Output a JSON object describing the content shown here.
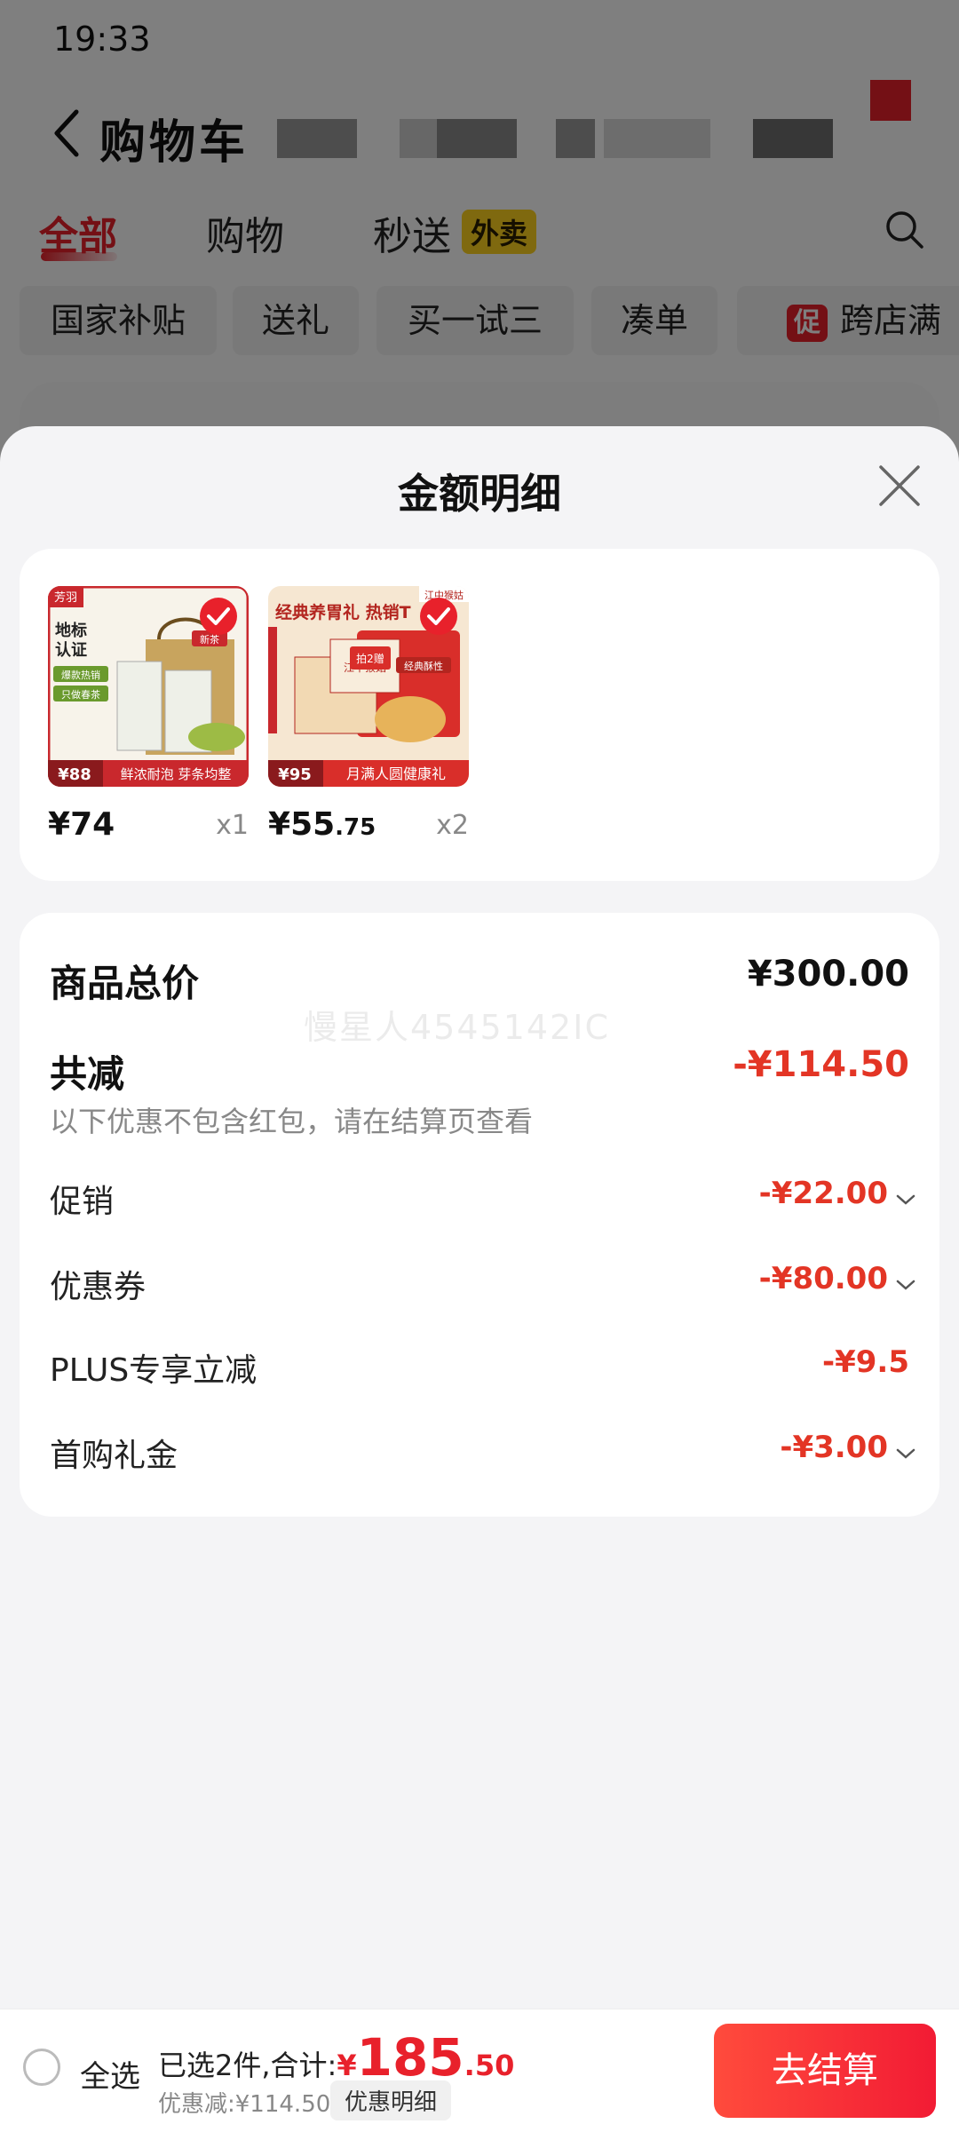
{
  "status_bar": {
    "time": "19:33"
  },
  "nav": {
    "title": "购物车"
  },
  "tabs": [
    {
      "label": "全部"
    },
    {
      "label": "购物"
    },
    {
      "label": "秒送"
    }
  ],
  "tab_badge": "外卖",
  "chips": [
    {
      "label": "国家补贴"
    },
    {
      "label": "送礼"
    },
    {
      "label": "买一试三"
    },
    {
      "label": "凑单"
    },
    {
      "label": "跨店满"
    }
  ],
  "promo_icon_text": "促",
  "sheet": {
    "title": "金额明细",
    "products": [
      {
        "price_symbol": "¥",
        "price_int": "74",
        "price_dec": "",
        "qty": "x1",
        "image": {
          "tag": "新茶",
          "title": "地标认证",
          "ribbon": [
            "爆款热销",
            "只做春茶"
          ],
          "bottom_price": "88",
          "bottom_text": "鲜浓耐泡 芽条均整",
          "brand": "芳羽"
        }
      },
      {
        "price_symbol": "¥",
        "price_int": "55",
        "price_dec": ".75",
        "qty": "x2",
        "image": {
          "headline": "经典养胃礼 热销T",
          "brand": "江中猴姑",
          "box_label": "经典酥性",
          "bottom_price": "95",
          "bottom_text": "月满人圆健康礼",
          "promo": "拍2赠"
        }
      }
    ],
    "summary": {
      "total_label": "商品总价",
      "total_value": "¥300.00",
      "reduce_label": "共减",
      "reduce_value": "-¥114.50",
      "note": "以下优惠不包含红包，请在结算页查看",
      "watermark": "慢星人4545142IC",
      "items": [
        {
          "label": "促销",
          "value": "-¥22.00",
          "expandable": true
        },
        {
          "label": "优惠券",
          "value": "-¥80.00",
          "expandable": true
        },
        {
          "label": "PLUS专享立减",
          "value": "-¥9.5",
          "expandable": false
        },
        {
          "label": "首购礼金",
          "value": "-¥3.00",
          "expandable": true
        }
      ]
    }
  },
  "bottom_bar": {
    "select_all": "全选",
    "selected_text": "已选2件,合计:",
    "currency": "¥",
    "total_int": "185",
    "total_dec": ".50",
    "discount_text": "优惠减:¥114.50",
    "detail_button": "优惠明细",
    "checkout_button": "去结算"
  },
  "colors": {
    "accent": "#e8212b",
    "minus": "#e33525",
    "badge": "#ffd21f"
  }
}
